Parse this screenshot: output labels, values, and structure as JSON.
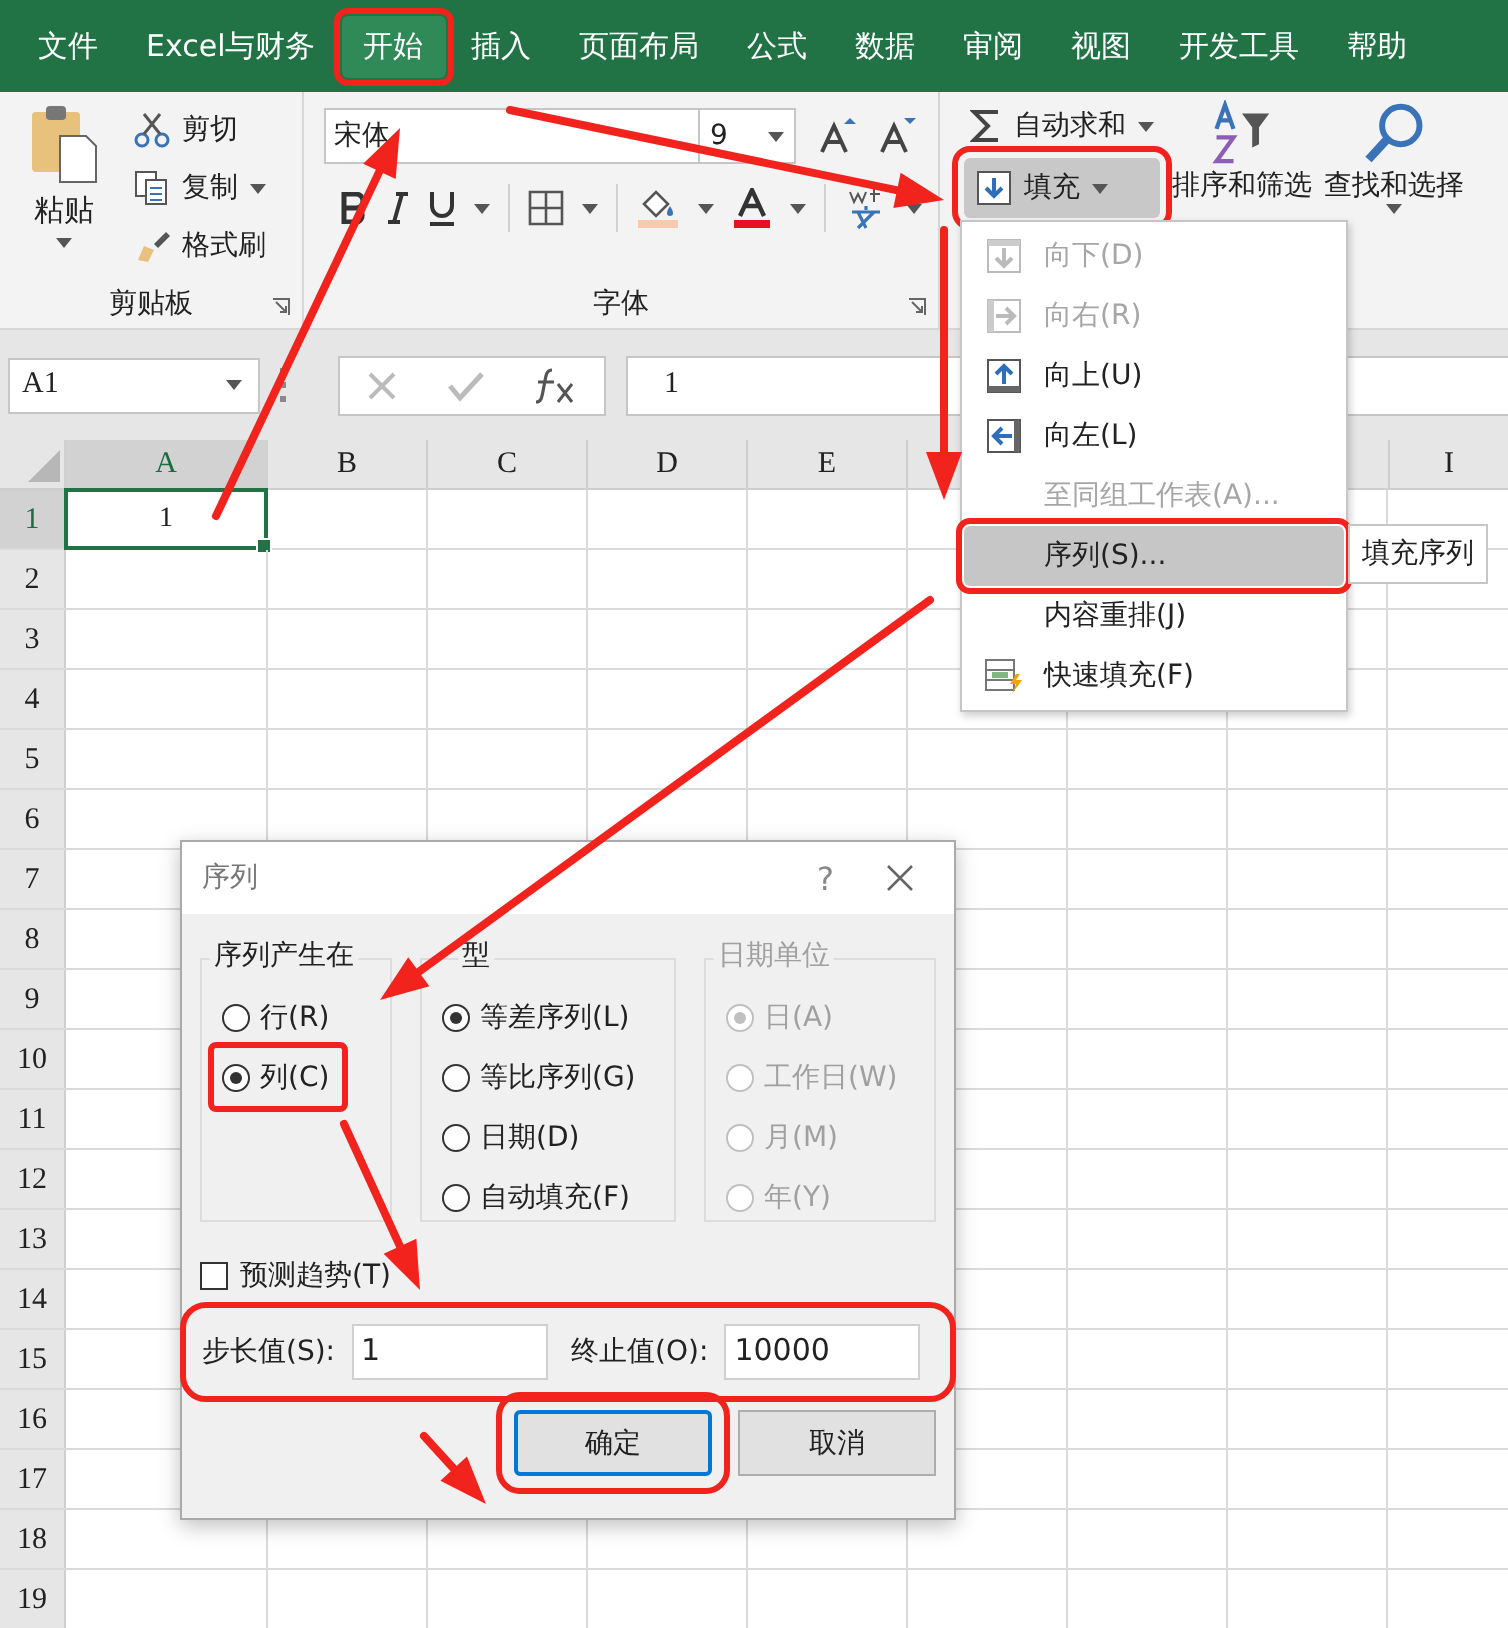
{
  "tabs": [
    {
      "label": "文件",
      "selected": false,
      "annotated": false
    },
    {
      "label": "Excel与财务",
      "selected": false,
      "annotated": false
    },
    {
      "label": "开始",
      "selected": true,
      "annotated": true
    },
    {
      "label": "插入",
      "selected": false,
      "annotated": false
    },
    {
      "label": "页面布局",
      "selected": false,
      "annotated": false
    },
    {
      "label": "公式",
      "selected": false,
      "annotated": false
    },
    {
      "label": "数据",
      "selected": false,
      "annotated": false
    },
    {
      "label": "审阅",
      "selected": false,
      "annotated": false
    },
    {
      "label": "视图",
      "selected": false,
      "annotated": false
    },
    {
      "label": "开发工具",
      "selected": false,
      "annotated": false
    },
    {
      "label": "帮助",
      "selected": false,
      "annotated": false
    }
  ],
  "clipboard": {
    "paste": "粘贴",
    "group_label": "剪贴板",
    "items": [
      {
        "label": "剪切",
        "kind": "cut",
        "dropdown": false
      },
      {
        "label": "复制",
        "kind": "copy",
        "dropdown": true
      },
      {
        "label": "格式刷",
        "kind": "brush",
        "dropdown": false
      }
    ]
  },
  "font": {
    "name": "宋体",
    "size": "9",
    "group_label": "字体"
  },
  "editing": {
    "autosum": "自动求和",
    "fill": {
      "label": "填充",
      "pressed": true,
      "annotated": true
    },
    "sort": "排序和筛选",
    "find": "查找和选择"
  },
  "name_box": "A1",
  "formula": "1",
  "columns": [
    {
      "label": "A",
      "selected": true
    },
    {
      "label": "B",
      "selected": false
    },
    {
      "label": "C",
      "selected": false
    },
    {
      "label": "D",
      "selected": false
    },
    {
      "label": "E",
      "selected": false
    },
    {
      "label": "I",
      "selected": false
    }
  ],
  "rows": [
    {
      "number": "1",
      "selected": true,
      "value": "1"
    },
    {
      "number": "2",
      "selected": false
    },
    {
      "number": "3",
      "selected": false
    },
    {
      "number": "4",
      "selected": false
    },
    {
      "number": "5",
      "selected": false
    },
    {
      "number": "6",
      "selected": false
    },
    {
      "number": "7",
      "selected": false
    },
    {
      "number": "8",
      "selected": false
    },
    {
      "number": "9",
      "selected": false
    },
    {
      "number": "10",
      "selected": false
    },
    {
      "number": "11",
      "selected": false
    },
    {
      "number": "12",
      "selected": false
    },
    {
      "number": "13",
      "selected": false
    },
    {
      "number": "14",
      "selected": false
    },
    {
      "number": "15",
      "selected": false
    },
    {
      "number": "16",
      "selected": false
    },
    {
      "number": "17",
      "selected": false
    },
    {
      "number": "18",
      "selected": false
    },
    {
      "number": "19",
      "selected": false
    }
  ],
  "fill_menu": {
    "tooltip": "填充序列",
    "items": [
      {
        "label": "向下(D)",
        "kind": "down",
        "disabled": true,
        "highlighted": false,
        "annotated": false
      },
      {
        "label": "向右(R)",
        "kind": "right",
        "disabled": true,
        "highlighted": false,
        "annotated": false
      },
      {
        "label": "向上(U)",
        "kind": "up",
        "disabled": false,
        "highlighted": false,
        "annotated": false
      },
      {
        "label": "向左(L)",
        "kind": "left",
        "disabled": false,
        "highlighted": false,
        "annotated": false
      },
      {
        "label": "至同组工作表(A)...",
        "kind": "sheets",
        "disabled": true,
        "highlighted": false,
        "annotated": false
      },
      {
        "label": "序列(S)...",
        "kind": "series",
        "disabled": false,
        "highlighted": true,
        "annotated": true
      },
      {
        "label": "内容重排(J)",
        "kind": "justify",
        "disabled": false,
        "highlighted": false,
        "annotated": false
      },
      {
        "label": "快速填充(F)",
        "kind": "flash",
        "disabled": false,
        "highlighted": false,
        "annotated": false
      }
    ]
  },
  "dialog": {
    "title": "序列",
    "help": "?",
    "groups": [
      {
        "title": "序列产生在",
        "disabled": false,
        "options": [
          {
            "label": "行(R)",
            "selected": false,
            "annotated": false
          },
          {
            "label": "列(C)",
            "selected": true,
            "annotated": true
          }
        ]
      },
      {
        "title": "型",
        "disabled": false,
        "options": [
          {
            "label": "等差序列(L)",
            "selected": true,
            "annotated": false
          },
          {
            "label": "等比序列(G)",
            "selected": false,
            "annotated": false
          },
          {
            "label": "日期(D)",
            "selected": false,
            "annotated": false
          },
          {
            "label": "自动填充(F)",
            "selected": false,
            "annotated": false
          }
        ]
      },
      {
        "title": "日期单位",
        "disabled": true,
        "options": [
          {
            "label": "日(A)",
            "selected": true,
            "annotated": false
          },
          {
            "label": "工作日(W)",
            "selected": false,
            "annotated": false
          },
          {
            "label": "月(M)",
            "selected": false,
            "annotated": false
          },
          {
            "label": "年(Y)",
            "selected": false,
            "annotated": false
          }
        ]
      }
    ],
    "trend": {
      "label": "预测趋势(T)",
      "checked": false
    },
    "fields_annotated": true,
    "step": {
      "label": "步长值(S):",
      "value": "1"
    },
    "stop": {
      "label": "终止值(O):",
      "value": "10000"
    },
    "buttons": [
      {
        "label": "确定",
        "default": true,
        "annotated": true
      },
      {
        "label": "取消",
        "default": false,
        "annotated": false
      }
    ]
  },
  "annotation": {
    "arrows": true
  }
}
